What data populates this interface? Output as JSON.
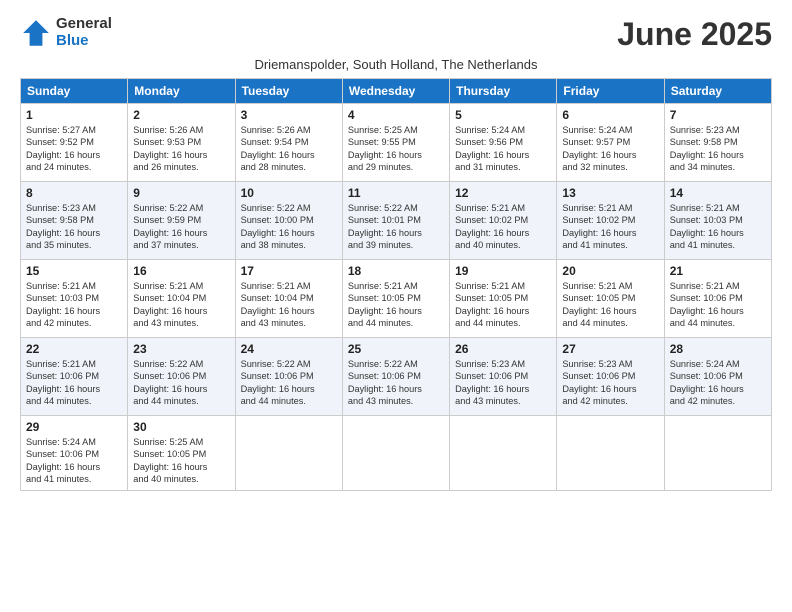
{
  "logo": {
    "general": "General",
    "blue": "Blue"
  },
  "title": "June 2025",
  "subtitle": "Driemanspolder, South Holland, The Netherlands",
  "weekdays": [
    "Sunday",
    "Monday",
    "Tuesday",
    "Wednesday",
    "Thursday",
    "Friday",
    "Saturday"
  ],
  "weeks": [
    [
      {
        "day": 1,
        "lines": [
          "Sunrise: 5:27 AM",
          "Sunset: 9:52 PM",
          "Daylight: 16 hours",
          "and 24 minutes."
        ]
      },
      {
        "day": 2,
        "lines": [
          "Sunrise: 5:26 AM",
          "Sunset: 9:53 PM",
          "Daylight: 16 hours",
          "and 26 minutes."
        ]
      },
      {
        "day": 3,
        "lines": [
          "Sunrise: 5:26 AM",
          "Sunset: 9:54 PM",
          "Daylight: 16 hours",
          "and 28 minutes."
        ]
      },
      {
        "day": 4,
        "lines": [
          "Sunrise: 5:25 AM",
          "Sunset: 9:55 PM",
          "Daylight: 16 hours",
          "and 29 minutes."
        ]
      },
      {
        "day": 5,
        "lines": [
          "Sunrise: 5:24 AM",
          "Sunset: 9:56 PM",
          "Daylight: 16 hours",
          "and 31 minutes."
        ]
      },
      {
        "day": 6,
        "lines": [
          "Sunrise: 5:24 AM",
          "Sunset: 9:57 PM",
          "Daylight: 16 hours",
          "and 32 minutes."
        ]
      },
      {
        "day": 7,
        "lines": [
          "Sunrise: 5:23 AM",
          "Sunset: 9:58 PM",
          "Daylight: 16 hours",
          "and 34 minutes."
        ]
      }
    ],
    [
      {
        "day": 8,
        "lines": [
          "Sunrise: 5:23 AM",
          "Sunset: 9:58 PM",
          "Daylight: 16 hours",
          "and 35 minutes."
        ]
      },
      {
        "day": 9,
        "lines": [
          "Sunrise: 5:22 AM",
          "Sunset: 9:59 PM",
          "Daylight: 16 hours",
          "and 37 minutes."
        ]
      },
      {
        "day": 10,
        "lines": [
          "Sunrise: 5:22 AM",
          "Sunset: 10:00 PM",
          "Daylight: 16 hours",
          "and 38 minutes."
        ]
      },
      {
        "day": 11,
        "lines": [
          "Sunrise: 5:22 AM",
          "Sunset: 10:01 PM",
          "Daylight: 16 hours",
          "and 39 minutes."
        ]
      },
      {
        "day": 12,
        "lines": [
          "Sunrise: 5:21 AM",
          "Sunset: 10:02 PM",
          "Daylight: 16 hours",
          "and 40 minutes."
        ]
      },
      {
        "day": 13,
        "lines": [
          "Sunrise: 5:21 AM",
          "Sunset: 10:02 PM",
          "Daylight: 16 hours",
          "and 41 minutes."
        ]
      },
      {
        "day": 14,
        "lines": [
          "Sunrise: 5:21 AM",
          "Sunset: 10:03 PM",
          "Daylight: 16 hours",
          "and 41 minutes."
        ]
      }
    ],
    [
      {
        "day": 15,
        "lines": [
          "Sunrise: 5:21 AM",
          "Sunset: 10:03 PM",
          "Daylight: 16 hours",
          "and 42 minutes."
        ]
      },
      {
        "day": 16,
        "lines": [
          "Sunrise: 5:21 AM",
          "Sunset: 10:04 PM",
          "Daylight: 16 hours",
          "and 43 minutes."
        ]
      },
      {
        "day": 17,
        "lines": [
          "Sunrise: 5:21 AM",
          "Sunset: 10:04 PM",
          "Daylight: 16 hours",
          "and 43 minutes."
        ]
      },
      {
        "day": 18,
        "lines": [
          "Sunrise: 5:21 AM",
          "Sunset: 10:05 PM",
          "Daylight: 16 hours",
          "and 44 minutes."
        ]
      },
      {
        "day": 19,
        "lines": [
          "Sunrise: 5:21 AM",
          "Sunset: 10:05 PM",
          "Daylight: 16 hours",
          "and 44 minutes."
        ]
      },
      {
        "day": 20,
        "lines": [
          "Sunrise: 5:21 AM",
          "Sunset: 10:05 PM",
          "Daylight: 16 hours",
          "and 44 minutes."
        ]
      },
      {
        "day": 21,
        "lines": [
          "Sunrise: 5:21 AM",
          "Sunset: 10:06 PM",
          "Daylight: 16 hours",
          "and 44 minutes."
        ]
      }
    ],
    [
      {
        "day": 22,
        "lines": [
          "Sunrise: 5:21 AM",
          "Sunset: 10:06 PM",
          "Daylight: 16 hours",
          "and 44 minutes."
        ]
      },
      {
        "day": 23,
        "lines": [
          "Sunrise: 5:22 AM",
          "Sunset: 10:06 PM",
          "Daylight: 16 hours",
          "and 44 minutes."
        ]
      },
      {
        "day": 24,
        "lines": [
          "Sunrise: 5:22 AM",
          "Sunset: 10:06 PM",
          "Daylight: 16 hours",
          "and 44 minutes."
        ]
      },
      {
        "day": 25,
        "lines": [
          "Sunrise: 5:22 AM",
          "Sunset: 10:06 PM",
          "Daylight: 16 hours",
          "and 43 minutes."
        ]
      },
      {
        "day": 26,
        "lines": [
          "Sunrise: 5:23 AM",
          "Sunset: 10:06 PM",
          "Daylight: 16 hours",
          "and 43 minutes."
        ]
      },
      {
        "day": 27,
        "lines": [
          "Sunrise: 5:23 AM",
          "Sunset: 10:06 PM",
          "Daylight: 16 hours",
          "and 42 minutes."
        ]
      },
      {
        "day": 28,
        "lines": [
          "Sunrise: 5:24 AM",
          "Sunset: 10:06 PM",
          "Daylight: 16 hours",
          "and 42 minutes."
        ]
      }
    ],
    [
      {
        "day": 29,
        "lines": [
          "Sunrise: 5:24 AM",
          "Sunset: 10:06 PM",
          "Daylight: 16 hours",
          "and 41 minutes."
        ]
      },
      {
        "day": 30,
        "lines": [
          "Sunrise: 5:25 AM",
          "Sunset: 10:05 PM",
          "Daylight: 16 hours",
          "and 40 minutes."
        ]
      },
      null,
      null,
      null,
      null,
      null
    ]
  ]
}
